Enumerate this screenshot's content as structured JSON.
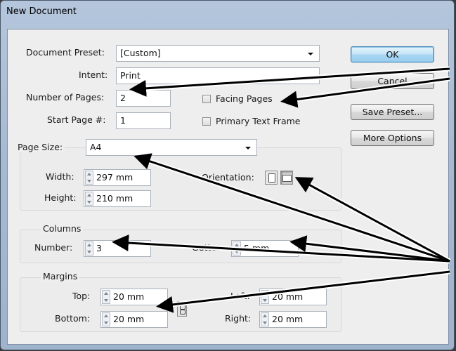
{
  "dialog": {
    "title": "New Document",
    "buttons": {
      "ok": "OK",
      "cancel": "Cancel",
      "save_preset": "Save Preset...",
      "more_options": "More Options"
    }
  },
  "document_preset": {
    "label": "Document Preset:",
    "value": "[Custom]"
  },
  "intent": {
    "label": "Intent:",
    "value": "Print"
  },
  "number_of_pages": {
    "label": "Number of Pages:",
    "value": "2"
  },
  "start_page": {
    "label": "Start Page #:",
    "value": "1"
  },
  "facing_pages": {
    "label": "Facing Pages",
    "checked": false
  },
  "primary_text_frame": {
    "label": "Primary Text Frame",
    "checked": false
  },
  "page_size": {
    "label": "Page Size:",
    "value": "A4",
    "width": {
      "label": "Width:",
      "value": "297 mm"
    },
    "height": {
      "label": "Height:",
      "value": "210 mm"
    },
    "orientation": {
      "label": "Orientation:",
      "options": [
        "portrait-icon",
        "landscape-icon"
      ],
      "selected": "landscape"
    }
  },
  "columns": {
    "label": "Columns",
    "number": {
      "label": "Number:",
      "value": "3"
    },
    "gutter": {
      "label": "Gutter:",
      "value": "5 mm"
    }
  },
  "margins": {
    "label": "Margins",
    "top": {
      "label": "Top:",
      "value": "20 mm"
    },
    "bottom": {
      "label": "Bottom:",
      "value": "20 mm"
    },
    "left": {
      "label": "Left:",
      "value": "20 mm"
    },
    "right": {
      "label": "Right:",
      "value": "20 mm"
    }
  },
  "annotation_arrows": {
    "color": "#000000",
    "count": 7
  }
}
